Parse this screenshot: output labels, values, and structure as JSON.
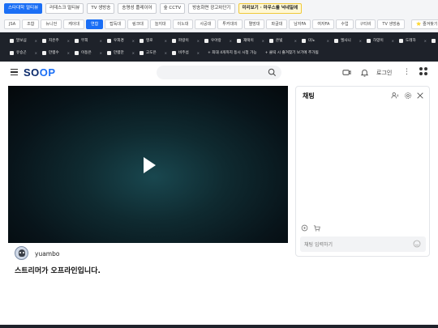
{
  "bookmarks": [
    {
      "label": "스타대학 멀티뷰",
      "style": "blue"
    },
    {
      "label": "러데스크 멀티뷰",
      "style": ""
    },
    {
      "label": "TV 생방송",
      "style": ""
    },
    {
      "label": "송명성 플레이어",
      "style": ""
    },
    {
      "label": "숲 CCTV",
      "style": ""
    },
    {
      "label": "방송화면 광고차단기",
      "style": ""
    },
    {
      "label": "미리보기 · 마우스를 넉네일에",
      "style": "yellow"
    }
  ],
  "categories": [
    {
      "label": "JSA",
      "active": false
    },
    {
      "label": "조합",
      "active": false
    },
    {
      "label": "뉴니언",
      "active": false
    },
    {
      "label": "케이대",
      "active": false
    },
    {
      "label": "연합",
      "active": true
    },
    {
      "label": "탑독대",
      "active": false
    },
    {
      "label": "링크대",
      "active": false
    },
    {
      "label": "늘지대",
      "active": false
    },
    {
      "label": "이노대",
      "active": false
    },
    {
      "label": "사공대",
      "active": false
    },
    {
      "label": "투커대의",
      "active": false
    },
    {
      "label": "멸망대",
      "active": false
    },
    {
      "label": "파글대",
      "active": false
    },
    {
      "label": "남자FA",
      "active": false
    },
    {
      "label": "여자FA",
      "active": false
    },
    {
      "label": "수업",
      "active": false
    },
    {
      "label": "구티비",
      "active": false
    },
    {
      "label": "TV 생방송",
      "active": false
    }
  ],
  "favorites_label": "⭐ 즐겨찾기 보기",
  "streamers_row1": [
    "말보심",
    "지은주",
    "무희",
    "우희경",
    "맹로",
    "파랑이",
    "우아랑",
    "재택이",
    "은빛",
    "미노",
    "엘사니",
    "하양이",
    "도레하",
    "이레온"
  ],
  "streamers_row2": [
    "유승곤",
    "만렙수",
    "이동은",
    "만렙만",
    "고도은",
    "비주섭"
  ],
  "dark_notes": [
    "+ 최대 4개까지 동시 시청 가능",
    "+ 클릭 시 즐겨찾기 보기에 추가됨"
  ],
  "header": {
    "logo_part1": "SO",
    "logo_part2": "OP",
    "search_placeholder": "",
    "login_label": "로그인"
  },
  "streamer": {
    "name": "yuambo",
    "status_text": "스트리머가 오프라인입니다."
  },
  "chat": {
    "title": "채팅",
    "input_placeholder": "채팅 입력하기"
  },
  "colors": {
    "accent": "#1a6ef5",
    "dark_bar": "#1e222a",
    "logo_navy": "#0b2a6b"
  }
}
